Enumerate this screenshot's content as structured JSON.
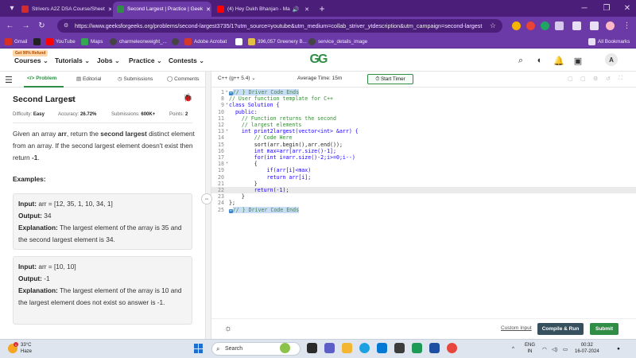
{
  "browser": {
    "tabs": [
      {
        "label": "Strivers A2Z DSA Course/Sheet",
        "color": "#d62b2b",
        "active": false
      },
      {
        "label": "Second Largest | Practice | Geek",
        "color": "#2f8d46",
        "active": true
      },
      {
        "label": "(4) Hey Dukh Bhanjan - Ma",
        "color": "#ff0000",
        "active": false
      }
    ],
    "new_tab": "+",
    "url": "https://www.geeksforgeeks.org/problems/second-largest3735/1?utm_source=youtube&utm_medium=collab_striver_ytdescription&utm_campaign=second-largest",
    "bookmarks": [
      {
        "label": "Gmail",
        "color": "#d93025"
      },
      {
        "label": "",
        "color": "#222222"
      },
      {
        "label": "YouTube",
        "color": "#ff0000"
      },
      {
        "label": "Maps",
        "color": "#34a853"
      },
      {
        "label": "charmeleonweight_...",
        "color": "#444444"
      },
      {
        "label": "",
        "color": "#444444"
      },
      {
        "label": "Adobe Acrobat",
        "color": "#d4372c"
      },
      {
        "label": "",
        "color": "#ffffff"
      },
      {
        "label": "396,057 Greenery B...",
        "color": "#e2c044"
      },
      {
        "label": "service_details_image",
        "color": "#444444"
      }
    ],
    "all_bookmarks": "All Bookmarks"
  },
  "site": {
    "refund_badge": "Get 90% Refund",
    "nav": [
      "Courses",
      "Tutorials",
      "Jobs",
      "Practice",
      "Contests"
    ],
    "logo": "GG",
    "avatar": "A"
  },
  "problem_tabs": {
    "problem": "Problem",
    "editorial": "Editorial",
    "submissions": "Submissions",
    "comments": "Comments"
  },
  "problem": {
    "title": "Second Largest",
    "difficulty_label": "Difficulty:",
    "difficulty": "Easy",
    "accuracy_label": "Accuracy:",
    "accuracy": "26.72%",
    "submissions_label": "Submissions:",
    "submissions": "600K+",
    "points_label": "Points:",
    "points": "2",
    "desc_1": "Given an array ",
    "desc_arr": "arr",
    "desc_2": ", return the ",
    "desc_bold": "second largest",
    "desc_3": " distinct element from an array. If the second largest element doesn't exist then return ",
    "desc_neg": "-1",
    "desc_4": ".",
    "examples_heading": "Examples:",
    "examples": [
      {
        "input_label": "Input:",
        "input": "arr = [12, 35, 1, 10, 34, 1]",
        "output_label": "Output:",
        "output": "34",
        "expl_label": "Explanation:",
        "explanation": "The largest element of the array is 35 and the second largest element is 34."
      },
      {
        "input_label": "Input:",
        "input": "arr = [10, 10]",
        "output_label": "Output:",
        "output": "-1",
        "expl_label": "Explanation:",
        "explanation": "The largest element of the array is 10 and the largest element does not exist so answer is -1."
      }
    ]
  },
  "editor": {
    "language": "C++ (g++ 5.4)",
    "avg_time": "Average Time: 15m",
    "start_timer": "Start Timer",
    "lines": [
      {
        "n": "1",
        "fold": "▸",
        "code": "// } Driver Code Ends",
        "tag": "↔",
        "style": "cm-sel"
      },
      {
        "n": "8",
        "fold": "",
        "code": "// User function template for C++",
        "style": "cm"
      },
      {
        "n": "9",
        "fold": "▾",
        "code": "class Solution {",
        "style": "kw"
      },
      {
        "n": "10",
        "fold": "",
        "code": "  public:",
        "style": "kw"
      },
      {
        "n": "11",
        "fold": "",
        "code": "    // Function returns the second",
        "style": "cm"
      },
      {
        "n": "12",
        "fold": "",
        "code": "    // largest elements",
        "style": "cm"
      },
      {
        "n": "13",
        "fold": "▾",
        "code": "    int print2largest(vector<int> &arr) {",
        "style": "kw"
      },
      {
        "n": "14",
        "fold": "",
        "code": "        // Code Here",
        "style": "cm"
      },
      {
        "n": "15",
        "fold": "",
        "code": "        sort(arr.begin(),arr.end());",
        "style": ""
      },
      {
        "n": "16",
        "fold": "",
        "code": "        int max=arr[arr.size()-1];",
        "style": "kw"
      },
      {
        "n": "17",
        "fold": "",
        "code": "        for(int i=arr.size()-2;i>=0;i--)",
        "style": "kw"
      },
      {
        "n": "18",
        "fold": "▾",
        "code": "        {",
        "style": ""
      },
      {
        "n": "19",
        "fold": "",
        "code": "            if(arr[i]<max)",
        "style": "kw"
      },
      {
        "n": "20",
        "fold": "",
        "code": "            return arr[i];",
        "style": "kw"
      },
      {
        "n": "21",
        "fold": "",
        "code": "        }",
        "style": ""
      },
      {
        "n": "22",
        "fold": "",
        "code": "        return(-1);",
        "style": "kw-hl"
      },
      {
        "n": "23",
        "fold": "",
        "code": "    }",
        "style": ""
      },
      {
        "n": "24",
        "fold": "",
        "code": "};",
        "style": ""
      },
      {
        "n": "25",
        "fold": "",
        "code": "// } Driver Code Ends",
        "tag": "↔",
        "style": "cm-sel"
      }
    ],
    "custom_input": "Custom Input",
    "compile_run": "Compile & Run",
    "submit": "Submit"
  },
  "taskbar": {
    "weather_temp": "33°C",
    "weather_desc": "Haze",
    "weather_badge": "1",
    "search_placeholder": "Search",
    "lang_1": "ENG",
    "lang_2": "IN",
    "time": "00:32",
    "date": "16-07-2024"
  }
}
